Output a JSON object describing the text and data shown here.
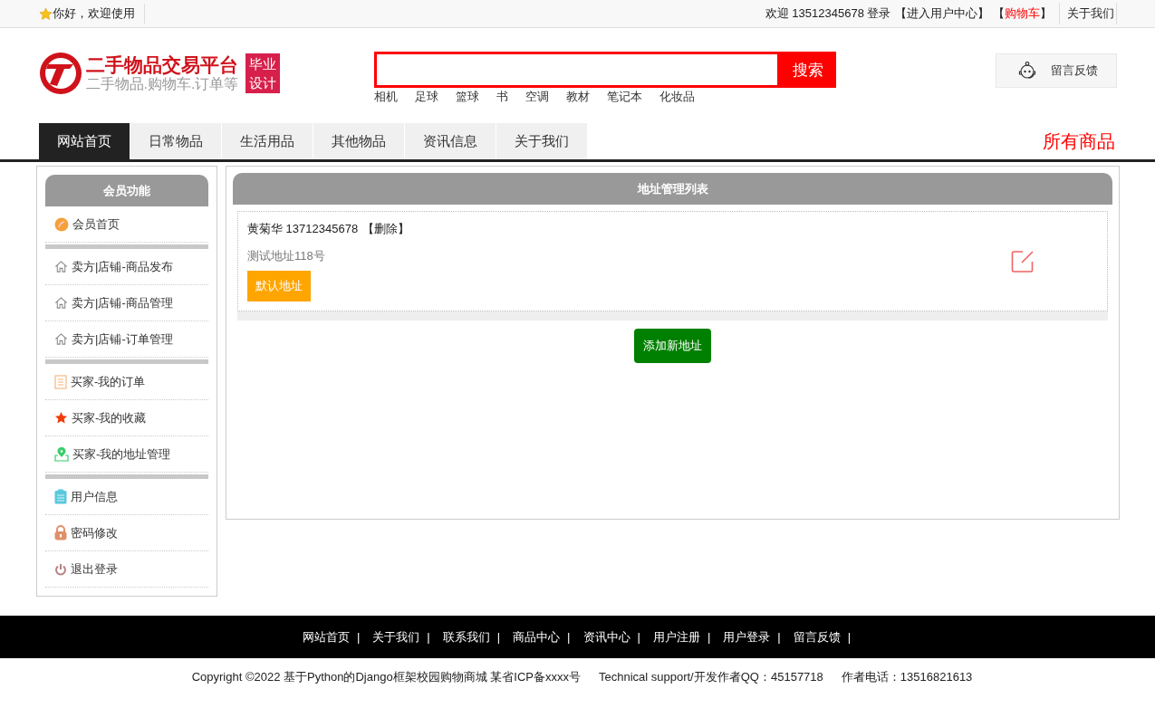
{
  "top_bar": {
    "greeting": "你好，欢迎使用",
    "welcome": "欢迎 13512345678 登录",
    "links": [
      {
        "open": "【",
        "label": "进入用户中心",
        "close": "】",
        "kind": "plain"
      },
      {
        "open": "【",
        "label": "购物车",
        "close": "】",
        "kind": "hot"
      }
    ],
    "about": "关于我们"
  },
  "header": {
    "site_title": "二手物品交易平台",
    "slogan": "二手物品.购物车.订单等",
    "badge": [
      "毕业",
      "设计"
    ],
    "search": {
      "button": "搜索"
    },
    "hot_keywords": [
      "相机",
      "足球",
      "篮球",
      "书",
      "空调",
      "教材",
      "笔记本",
      "化妆品"
    ],
    "feedback": "留言反馈"
  },
  "nav": {
    "tabs": [
      {
        "label": "网站首页",
        "selected": true
      },
      {
        "label": "日常物品",
        "selected": false
      },
      {
        "label": "生活用品",
        "selected": false
      },
      {
        "label": "其他物品",
        "selected": false
      },
      {
        "label": "资讯信息",
        "selected": false
      },
      {
        "label": "关于我们",
        "selected": false
      }
    ],
    "all_goods": "所有商品"
  },
  "sidebar": {
    "title": "会员功能",
    "groups": [
      [
        {
          "label": "会员首页",
          "kind": "dot"
        }
      ],
      [
        {
          "label": "卖方|店铺-商品发布",
          "kind": "home"
        },
        {
          "label": "卖方|店铺-商品管理",
          "kind": "home"
        },
        {
          "label": "卖方|店铺-订单管理",
          "kind": "home"
        }
      ],
      [
        {
          "label": "买家-我的订单",
          "kind": "list"
        },
        {
          "label": "买家-我的收藏",
          "kind": "star"
        },
        {
          "label": "买家-我的地址管理",
          "kind": "pin"
        }
      ],
      [
        {
          "label": "用户信息",
          "kind": "clipboard"
        },
        {
          "label": "密码修改",
          "kind": "lock"
        },
        {
          "label": "退出登录",
          "kind": "power"
        }
      ]
    ]
  },
  "address_panel": {
    "title": "地址管理列表",
    "addresses": [
      {
        "name": "黄菊华",
        "phone": "13712345678",
        "delete": "【删除】",
        "address": "测试地址118号",
        "default_label": "默认地址",
        "is_default": true
      }
    ],
    "add_button": "添加新地址"
  },
  "footer": {
    "links": [
      {
        "label": "网站首页",
        "sep": "|"
      },
      {
        "label": "关于我们",
        "sep": "|"
      },
      {
        "label": "联系我们",
        "sep": "|"
      },
      {
        "label": "商品中心",
        "sep": "|"
      },
      {
        "label": "资讯中心",
        "sep": "|"
      },
      {
        "label": "用户注册",
        "sep": "|"
      },
      {
        "label": "用户登录",
        "sep": "|"
      },
      {
        "label": "留言反馈",
        "sep": "|"
      }
    ],
    "copyright": [
      "Copyright ©2022 基于Python的Django框架校园购物商城 某省ICP备xxxx号",
      "Technical support/开发作者QQ：45157718",
      "作者电话：13516821613"
    ]
  }
}
